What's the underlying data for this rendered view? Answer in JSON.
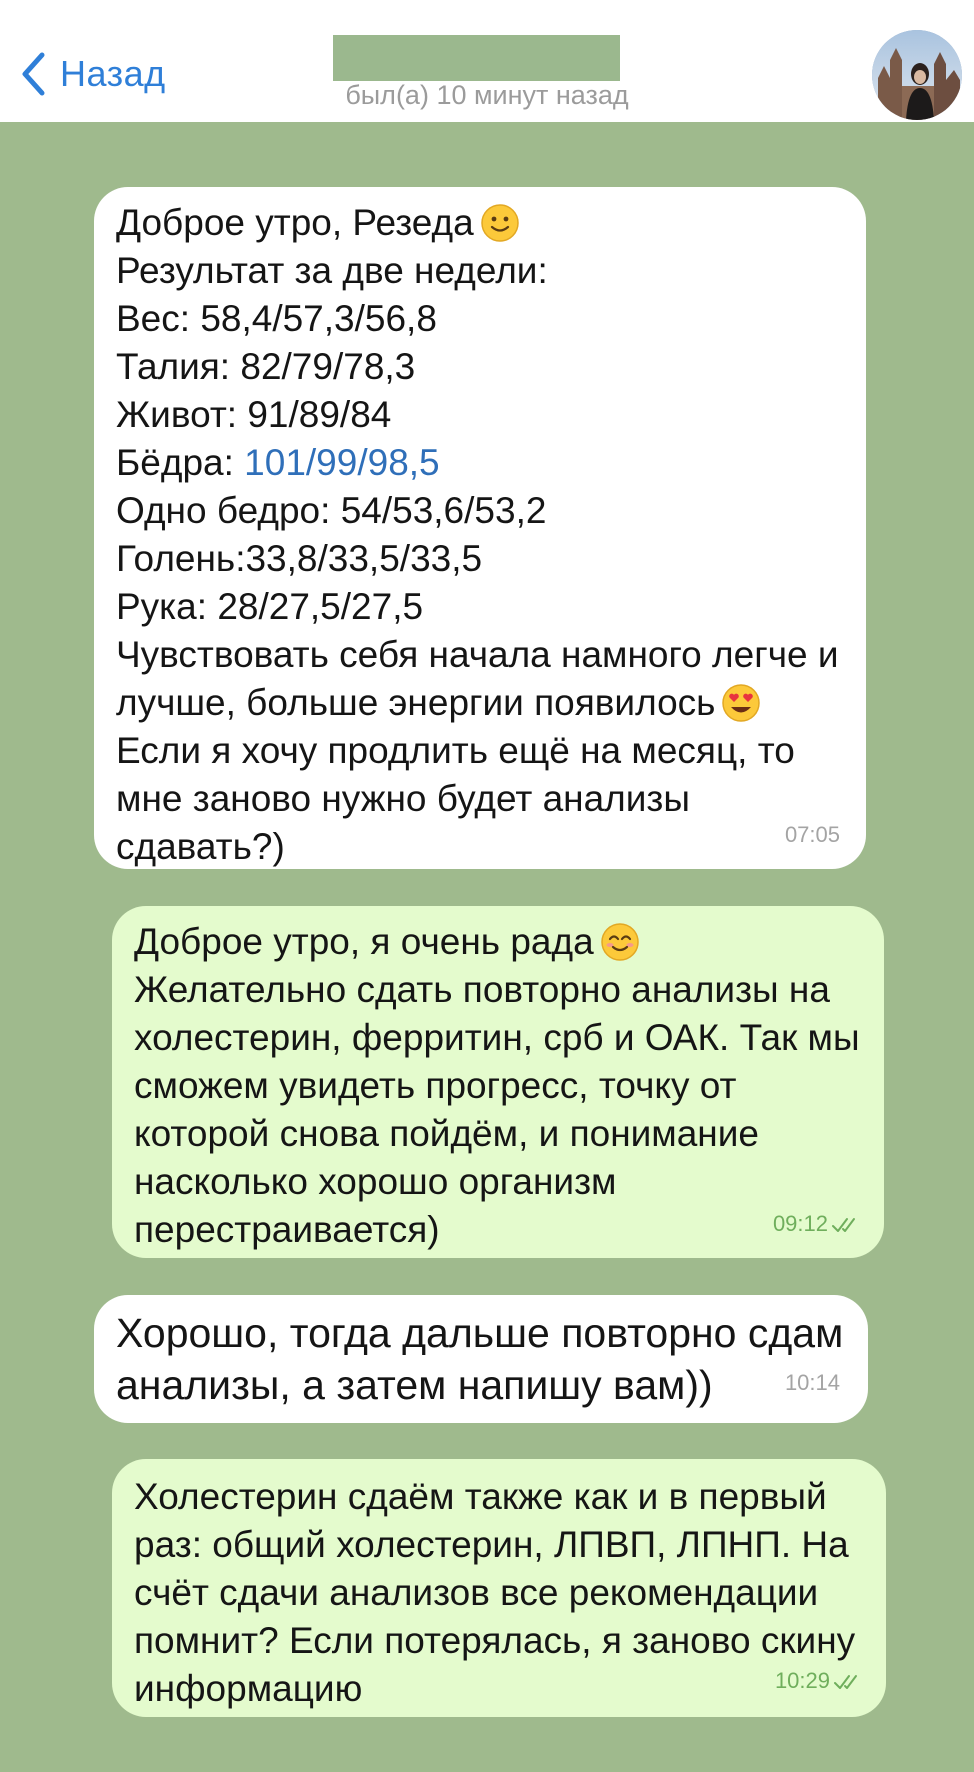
{
  "header": {
    "back_label": "Назад",
    "status": "был(а) 10 минут назад"
  },
  "messages": [
    {
      "direction": "in",
      "lines": [
        "Доброе утро, Резеда",
        "Результат за две недели:",
        "Вес: 58,4/57,3/56,8",
        "Талия: 82/79/78,3",
        "Живот: 91/89/84",
        "Бёдра: ",
        "Одно бедро: 54/53,6/53,2",
        "Голень:33,8/33,5/33,5",
        "Рука: 28/27,5/27,5",
        "Чувствовать себя начала намного легче и",
        "лучше, больше энергии появилось",
        "Если я хочу продлить ещё на месяц, то",
        "мне заново нужно будет анализы",
        "сдавать?)"
      ],
      "hips_link": "101/99/98,5",
      "time": "07:05"
    },
    {
      "direction": "out",
      "lines": [
        "Доброе утро, я очень рада",
        "Желательно сдать повторно анализы на",
        "холестерин, ферритин, срб и ОАК. Так мы",
        "сможем увидеть прогресс, точку от",
        "которой снова пойдём, и понимание",
        "насколько хорошо организм",
        "перестраивается)"
      ],
      "time": "09:12",
      "status": "read"
    },
    {
      "direction": "in",
      "lines": [
        "Хорошо, тогда дальше повторно сдам",
        "анализы, а затем напишу вам))"
      ],
      "time": "10:14"
    },
    {
      "direction": "out",
      "lines": [
        "Холестерин сдаём также как и в первый",
        "раз: общий холестерин, ЛПВП, ЛПНП. На",
        "счёт сдачи анализов все рекомендации",
        "помнит? Если потерялась, я заново скину",
        "информацию"
      ],
      "time": "10:29",
      "status": "read"
    }
  ],
  "colors": {
    "accent": "#2f7fd8",
    "chat_background": "#9fba8d",
    "incoming_bubble": "#ffffff",
    "outgoing_bubble": "#e4fbcd",
    "outgoing_time": "#6fae5c"
  },
  "icons": [
    "chevron-left-icon",
    "slightly-smiling-face-emoji",
    "heart-eyes-emoji",
    "smiling-face-emoji",
    "double-check-icon"
  ]
}
